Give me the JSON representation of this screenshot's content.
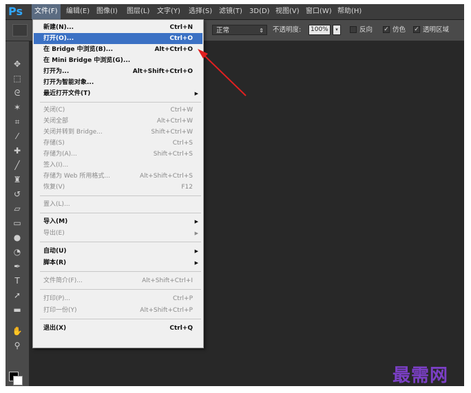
{
  "app": {
    "logo": "Ps",
    "menubar": [
      {
        "label": "文件(F)",
        "active": true
      },
      {
        "label": "编辑(E)"
      },
      {
        "label": "图像(I)"
      },
      {
        "label": "图层(L)"
      },
      {
        "label": "文字(Y)"
      },
      {
        "label": "选择(S)"
      },
      {
        "label": "滤镜(T)"
      },
      {
        "label": "3D(D)"
      },
      {
        "label": "视图(V)"
      },
      {
        "label": "窗口(W)"
      },
      {
        "label": "帮助(H)"
      }
    ]
  },
  "options": {
    "mode": "正常",
    "opacity_label": "不透明度:",
    "opacity_value": "100%",
    "reverse_label": "反向",
    "dither_label": "仿色",
    "transparency_label": "透明区域"
  },
  "file_menu": [
    {
      "label": "新建(N)...",
      "shortcut": "Ctrl+N"
    },
    {
      "label": "打开(O)...",
      "shortcut": "Ctrl+O",
      "highlight": true
    },
    {
      "label": "在 Bridge 中浏览(B)...",
      "shortcut": "Alt+Ctrl+O"
    },
    {
      "label": "在 Mini Bridge 中浏览(G)...",
      "shortcut": ""
    },
    {
      "label": "打开为...",
      "shortcut": "Alt+Shift+Ctrl+O"
    },
    {
      "label": "打开为智能对象...",
      "shortcut": ""
    },
    {
      "label": "最近打开文件(T)",
      "shortcut": "",
      "submenu": true
    },
    {
      "label": "关闭(C)",
      "shortcut": "Ctrl+W",
      "disabled": true
    },
    {
      "label": "关闭全部",
      "shortcut": "Alt+Ctrl+W",
      "disabled": true
    },
    {
      "label": "关闭并转到 Bridge...",
      "shortcut": "Shift+Ctrl+W",
      "disabled": true
    },
    {
      "label": "存储(S)",
      "shortcut": "Ctrl+S",
      "disabled": true
    },
    {
      "label": "存储为(A)...",
      "shortcut": "Shift+Ctrl+S",
      "disabled": true
    },
    {
      "label": "签入(I)...",
      "shortcut": "",
      "disabled": true
    },
    {
      "label": "存储为 Web 所用格式...",
      "shortcut": "Alt+Shift+Ctrl+S",
      "disabled": true
    },
    {
      "label": "恢复(V)",
      "shortcut": "F12",
      "disabled": true
    },
    {
      "label": "置入(L)...",
      "shortcut": "",
      "disabled": true
    },
    {
      "label": "导入(M)",
      "shortcut": "",
      "submenu": true
    },
    {
      "label": "导出(E)",
      "shortcut": "",
      "submenu": true,
      "disabled": true
    },
    {
      "label": "自动(U)",
      "shortcut": "",
      "submenu": true
    },
    {
      "label": "脚本(R)",
      "shortcut": "",
      "submenu": true
    },
    {
      "label": "文件简介(F)...",
      "shortcut": "Alt+Shift+Ctrl+I",
      "disabled": true
    },
    {
      "label": "打印(P)...",
      "shortcut": "Ctrl+P",
      "disabled": true
    },
    {
      "label": "打印一份(Y)",
      "shortcut": "Alt+Shift+Ctrl+P",
      "disabled": true
    },
    {
      "label": "退出(X)",
      "shortcut": "Ctrl+Q"
    }
  ],
  "watermark": "最需网",
  "colors": {
    "accent": "#31a8ff",
    "highlight": "#3b71c4",
    "arrow": "#e02020",
    "watermark": "#7b3fc6"
  },
  "icons": [
    "move-icon",
    "marquee-icon",
    "lasso-icon",
    "magic-wand-icon",
    "crop-icon",
    "eyedropper-icon",
    "healing-icon",
    "brush-icon",
    "stamp-icon",
    "history-brush-icon",
    "eraser-icon",
    "gradient-icon",
    "blur-icon",
    "dodge-icon",
    "pen-icon",
    "type-icon",
    "path-select-icon",
    "shape-icon",
    "hand-icon",
    "zoom-icon"
  ]
}
